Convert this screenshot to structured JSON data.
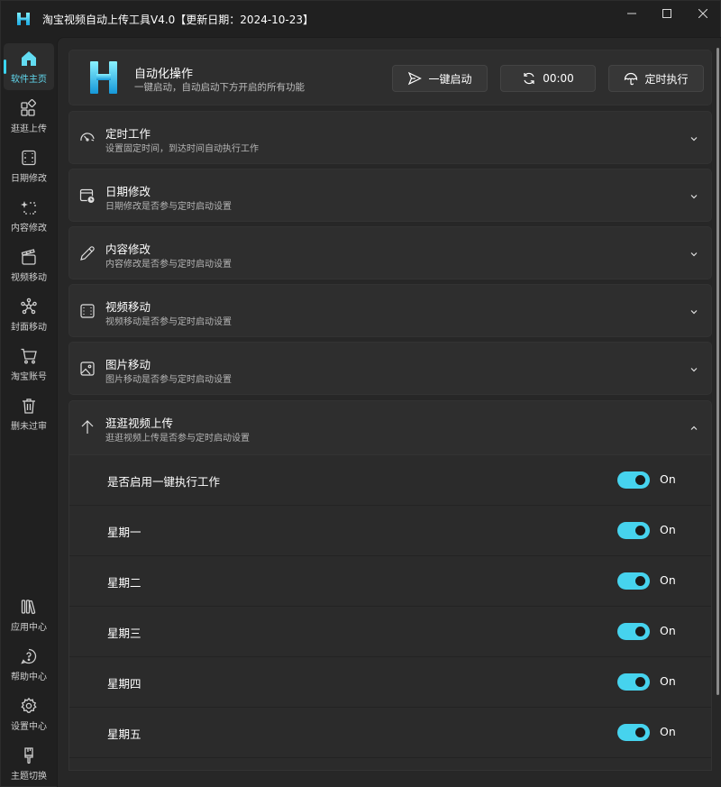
{
  "window": {
    "title": "淘宝视频自动上传工具V4.0【更新日期：2024-10-23】",
    "accent": "#46d3ee"
  },
  "sidebar": {
    "top_items": [
      {
        "label": "软件主页",
        "icon": "home-icon",
        "active": true
      },
      {
        "label": "逛逛上传",
        "icon": "apps-add-icon"
      },
      {
        "label": "日期修改",
        "icon": "film-frame-icon"
      },
      {
        "label": "内容修改",
        "icon": "sparkle-crop-icon"
      },
      {
        "label": "视频移动",
        "icon": "clapperboard-icon"
      },
      {
        "label": "封面移动",
        "icon": "network-nodes-icon"
      },
      {
        "label": "淘宝账号",
        "icon": "shopping-cart-icon"
      },
      {
        "label": "删未过审",
        "icon": "trash-icon"
      }
    ],
    "bottom_items": [
      {
        "label": "应用中心",
        "icon": "library-icon"
      },
      {
        "label": "帮助中心",
        "icon": "help-chat-icon"
      },
      {
        "label": "设置中心",
        "icon": "gear-icon"
      },
      {
        "label": "主题切换",
        "icon": "paintbrush-icon"
      }
    ]
  },
  "header": {
    "title": "自动化操作",
    "subtitle": "一键启动，自动启动下方开启的所有功能",
    "buttons": [
      {
        "label": "一键启动",
        "icon": "send-icon"
      },
      {
        "label": "00:00",
        "icon": "sync-icon"
      },
      {
        "label": "定时执行",
        "icon": "umbrella-icon"
      }
    ]
  },
  "sections": [
    {
      "title": "定时工作",
      "subtitle": "设置固定时间，到达时间自动执行工作",
      "icon": "speedometer-icon",
      "expanded": false
    },
    {
      "title": "日期修改",
      "subtitle": "日期修改是否参与定时启动设置",
      "icon": "calendar-clock-icon",
      "expanded": false
    },
    {
      "title": "内容修改",
      "subtitle": "内容修改是否参与定时启动设置",
      "icon": "pencil-icon",
      "expanded": false
    },
    {
      "title": "视频移动",
      "subtitle": "视频移动是否参与定时启动设置",
      "icon": "film-frame-icon",
      "expanded": false
    },
    {
      "title": "图片移动",
      "subtitle": "图片移动是否参与定时启动设置",
      "icon": "image-icon",
      "expanded": false
    },
    {
      "title": "逛逛视频上传",
      "subtitle": "逛逛视频上传是否参与定时启动设置",
      "icon": "arrow-up-icon",
      "expanded": true
    }
  ],
  "settings_rows": [
    {
      "label": "是否启用一键执行工作",
      "state": "On",
      "enabled": true
    },
    {
      "label": "星期一",
      "state": "On",
      "enabled": true
    },
    {
      "label": "星期二",
      "state": "On",
      "enabled": true
    },
    {
      "label": "星期三",
      "state": "On",
      "enabled": true
    },
    {
      "label": "星期四",
      "state": "On",
      "enabled": true
    },
    {
      "label": "星期五",
      "state": "On",
      "enabled": true
    },
    {
      "label": "",
      "state": "",
      "enabled": true
    }
  ]
}
